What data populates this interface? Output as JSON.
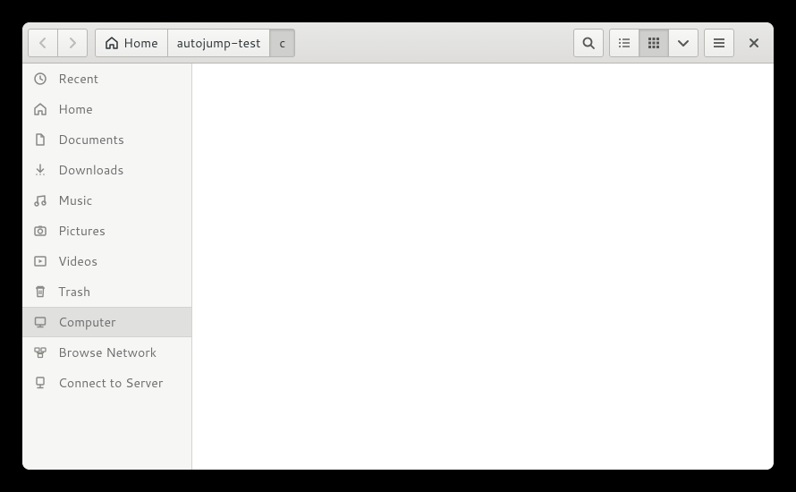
{
  "pathbar": {
    "segments": [
      {
        "label": "Home",
        "icon": "home"
      },
      {
        "label": "autojump-test"
      },
      {
        "label": "c",
        "active": true
      }
    ]
  },
  "nav": {
    "back_enabled": false,
    "forward_enabled": false
  },
  "toolbar": {
    "view_mode": "grid"
  },
  "sidebar": {
    "items": [
      {
        "icon": "recent",
        "label": "Recent"
      },
      {
        "icon": "home",
        "label": "Home"
      },
      {
        "icon": "document",
        "label": "Documents"
      },
      {
        "icon": "download",
        "label": "Downloads"
      },
      {
        "icon": "music",
        "label": "Music"
      },
      {
        "icon": "pictures",
        "label": "Pictures"
      },
      {
        "icon": "videos",
        "label": "Videos"
      },
      {
        "icon": "trash",
        "label": "Trash"
      },
      {
        "icon": "computer",
        "label": "Computer",
        "selected": true
      },
      {
        "icon": "network",
        "label": "Browse Network"
      },
      {
        "icon": "server",
        "label": "Connect to Server"
      }
    ]
  }
}
